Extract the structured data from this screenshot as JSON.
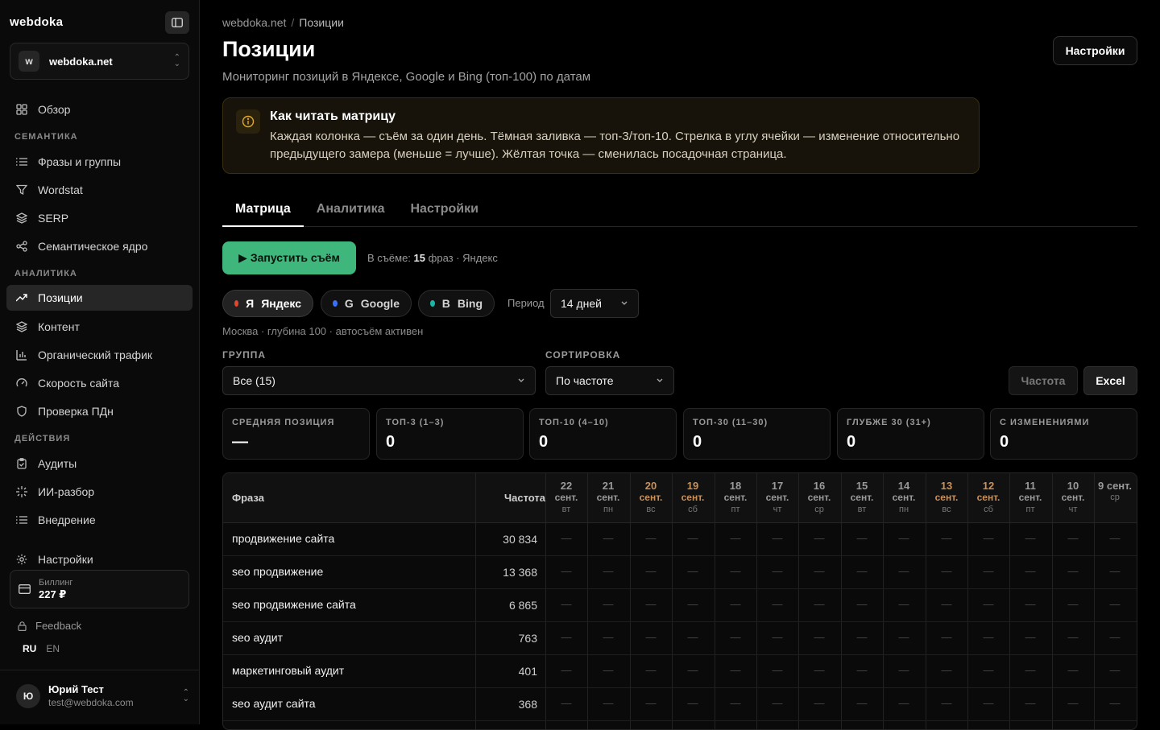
{
  "sidebar": {
    "brand": "webdoka",
    "site": {
      "avatar": "w",
      "name": "webdoka.net"
    },
    "overview": "Обзор",
    "sections": {
      "semantics": "СЕМАНТИКА",
      "analytics": "АНАЛИТИКА",
      "actions": "ДЕЙСТВИЯ"
    },
    "items": {
      "phrases": "Фразы и группы",
      "wordstat": "Wordstat",
      "serp": "SERP",
      "core": "Семантическое ядро",
      "positions": "Позиции",
      "content": "Контент",
      "traffic": "Органический трафик",
      "speed": "Скорость сайта",
      "pdn": "Проверка ПДн",
      "audits": "Аудиты",
      "ai": "ИИ-разбор",
      "implement": "Внедрение",
      "settings": "Настройки"
    },
    "billing": {
      "label": "Биллинг",
      "value": "227 ₽"
    },
    "feedback": "Feedback",
    "lang": {
      "ru": "RU",
      "en": "EN"
    },
    "user": {
      "avatar": "Ю",
      "name": "Юрий Тест",
      "email": "test@webdoka.com"
    }
  },
  "header": {
    "breadcrumb": [
      "webdoka.net",
      "Позиции"
    ],
    "breadcrumb_sep": "/",
    "title": "Позиции",
    "subtitle": "Мониторинг позиций в Яндексе, Google и Bing (топ-100) по датам",
    "settings_button": "Настройки"
  },
  "info": {
    "title": "Как читать матрицу",
    "text": "Каждая колонка — съём за один день. Тёмная заливка — топ-3/топ-10. Стрелка в углу ячейки — изменение относительно предыдущего замера (меньше = лучше). Жёлтая точка — сменилась посадочная страница."
  },
  "tabs": [
    "Матрица",
    "Аналитика",
    "Настройки"
  ],
  "run": {
    "button": "▶ Запустить съём",
    "info_prefix": "В съёме:",
    "info_count": "15",
    "info_suffix": "фраз · Яндекс"
  },
  "engines": [
    {
      "letter": "Я",
      "name": "Яндекс",
      "color": "#e5452f"
    },
    {
      "letter": "G",
      "name": "Google",
      "color": "#3b6ff5"
    },
    {
      "letter": "B",
      "name": "Bing",
      "color": "#1bb5a5"
    }
  ],
  "period": {
    "label": "Период",
    "value": "14 дней"
  },
  "region": "Москва · глубина 100 · автосъём активен",
  "filters": {
    "group_label": "ГРУППА",
    "group_value": "Все (15)",
    "sort_label": "СОРТИРОВКА",
    "sort_value": "По частоте",
    "freq_button": "Частота",
    "excel_button": "Excel"
  },
  "stats": [
    {
      "label": "СРЕДНЯЯ ПОЗИЦИЯ",
      "value": "—"
    },
    {
      "label": "ТОП-3 (1–3)",
      "value": "0"
    },
    {
      "label": "ТОП-10 (4–10)",
      "value": "0"
    },
    {
      "label": "ТОП-30 (11–30)",
      "value": "0"
    },
    {
      "label": "ГЛУБЖЕ 30 (31+)",
      "value": "0"
    },
    {
      "label": "С ИЗМЕНЕНИЯМИ",
      "value": "0"
    }
  ],
  "table": {
    "col_phrase": "Фраза",
    "col_freq": "Частота",
    "dates": [
      {
        "d": "22",
        "m": "сент.",
        "w": "вт",
        "weekend": false
      },
      {
        "d": "21",
        "m": "сент.",
        "w": "пн",
        "weekend": false
      },
      {
        "d": "20",
        "m": "сент.",
        "w": "вс",
        "weekend": true
      },
      {
        "d": "19",
        "m": "сент.",
        "w": "сб",
        "weekend": true
      },
      {
        "d": "18",
        "m": "сент.",
        "w": "пт",
        "weekend": false
      },
      {
        "d": "17",
        "m": "сент.",
        "w": "чт",
        "weekend": false
      },
      {
        "d": "16",
        "m": "сент.",
        "w": "ср",
        "weekend": false
      },
      {
        "d": "15",
        "m": "сент.",
        "w": "вт",
        "weekend": false
      },
      {
        "d": "14",
        "m": "сент.",
        "w": "пн",
        "weekend": false
      },
      {
        "d": "13",
        "m": "сент.",
        "w": "вс",
        "weekend": true
      },
      {
        "d": "12",
        "m": "сент.",
        "w": "сб",
        "weekend": true
      },
      {
        "d": "11",
        "m": "сент.",
        "w": "пт",
        "weekend": false
      },
      {
        "d": "10",
        "m": "сент.",
        "w": "чт",
        "weekend": false
      },
      {
        "d": "9 сент.",
        "m": "",
        "w": "ср",
        "weekend": false
      }
    ],
    "empty_cell": "—",
    "rows": [
      {
        "phrase": "продвижение сайта",
        "freq": "30 834"
      },
      {
        "phrase": "seo продвижение",
        "freq": "13 368"
      },
      {
        "phrase": "seo продвижение сайта",
        "freq": "6 865"
      },
      {
        "phrase": "seo аудит",
        "freq": "763"
      },
      {
        "phrase": "маркетинговый аудит",
        "freq": "401"
      },
      {
        "phrase": "seo аудит сайта",
        "freq": "368"
      }
    ]
  }
}
